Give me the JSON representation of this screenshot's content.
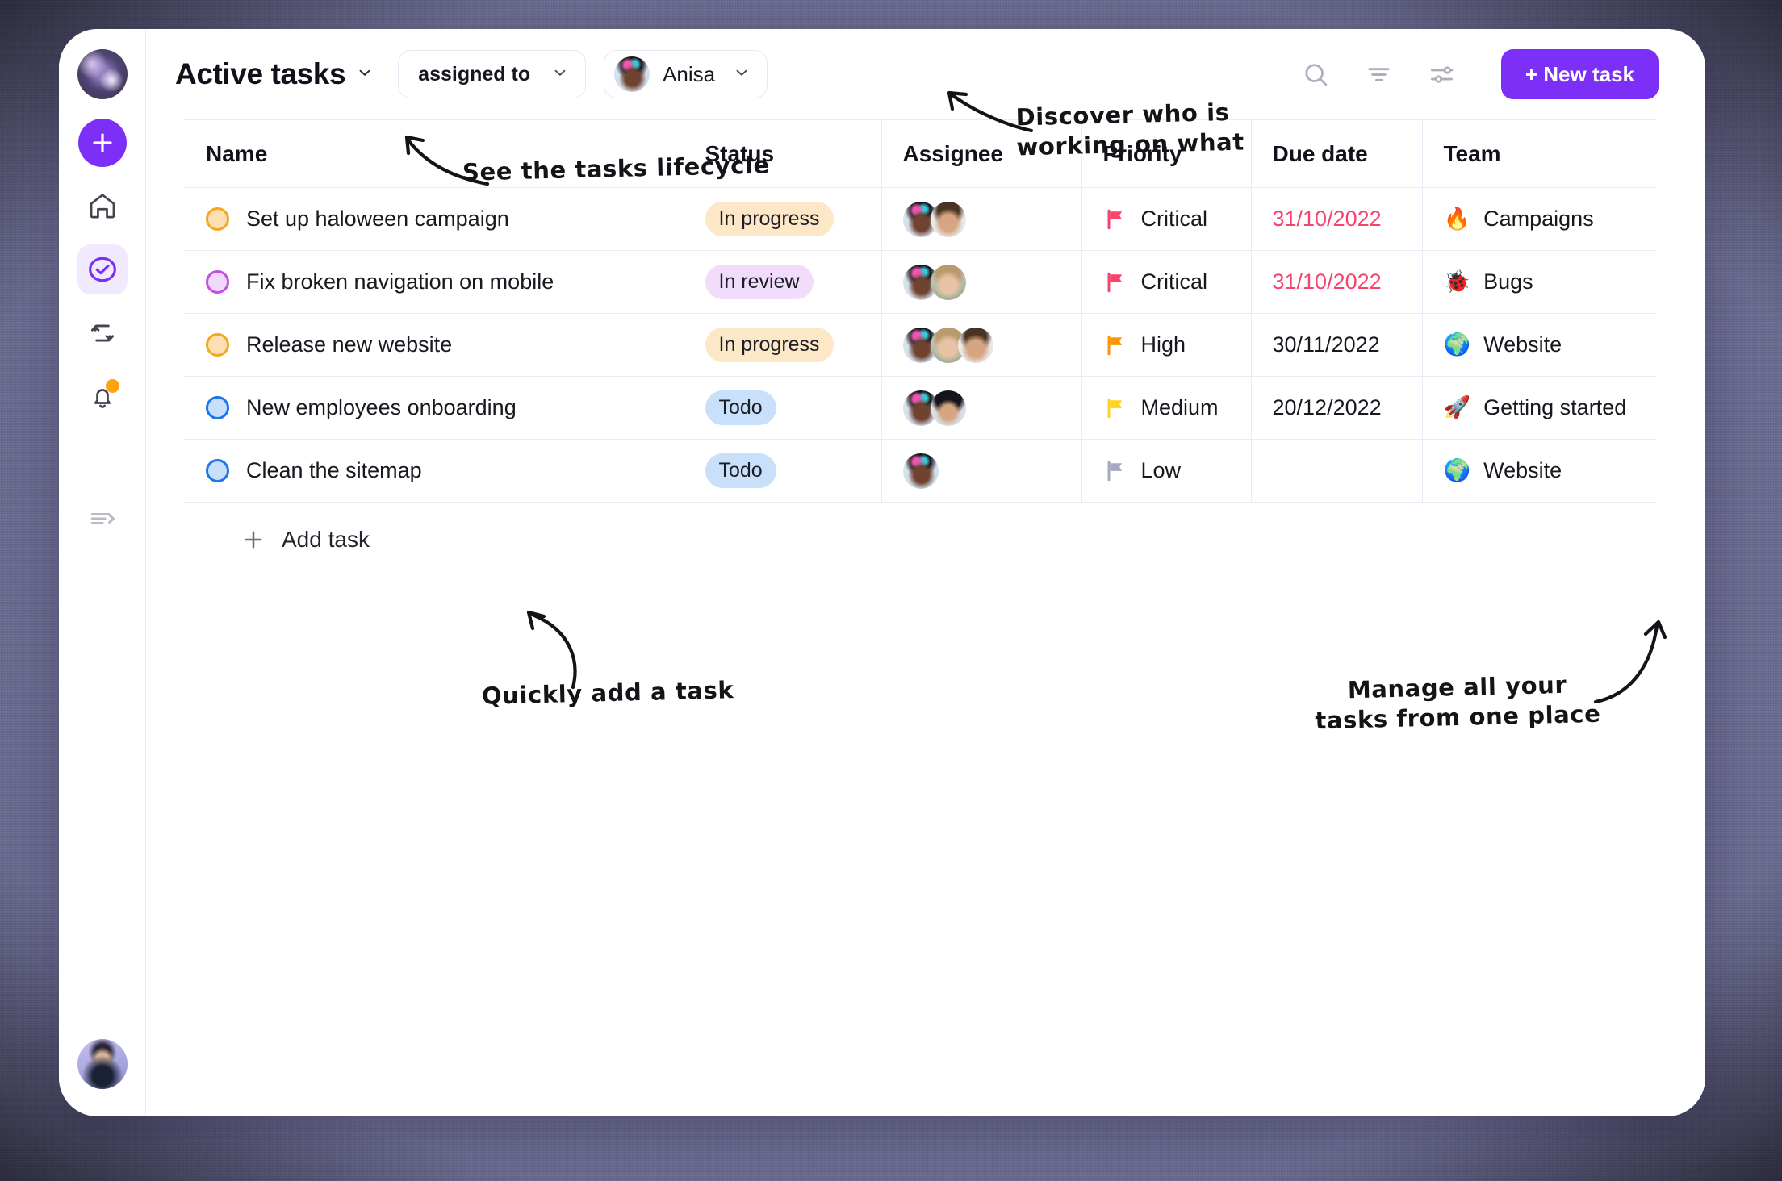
{
  "rail": {
    "workspace_name": "workspace-avatar",
    "add_label": "+",
    "items": [
      {
        "name": "home",
        "label": "Home"
      },
      {
        "name": "tasks",
        "label": "Tasks"
      },
      {
        "name": "sync",
        "label": "Sync"
      },
      {
        "name": "notifications",
        "label": "Notifications"
      }
    ],
    "collapse_label": "Expand sidebar",
    "user_label": "user-avatar"
  },
  "header": {
    "title": "Active tasks",
    "filter_label": "assigned to",
    "user_filter": "Anisa",
    "new_task_label": "+ New task",
    "search_icon": "search-icon",
    "filter_icon": "filter-icon",
    "settings_icon": "sliders-icon"
  },
  "table": {
    "columns": [
      "Name",
      "Status",
      "Assignee",
      "Priority",
      "Due date",
      "Team"
    ],
    "rows": [
      {
        "name": "Set up haloween campaign",
        "dot": "orange",
        "status": "In progress",
        "status_style": "progress",
        "assignees": [
          "a1",
          "a2"
        ],
        "priority": "Critical",
        "priority_color": "#f8436c",
        "due": "31/10/2022",
        "due_overdue": true,
        "team": "Campaigns",
        "team_emoji": "🔥"
      },
      {
        "name": "Fix broken navigation on mobile",
        "dot": "purple",
        "status": "In review",
        "status_style": "review",
        "assignees": [
          "a1",
          "a3"
        ],
        "priority": "Critical",
        "priority_color": "#f8436c",
        "due": "31/10/2022",
        "due_overdue": true,
        "team": "Bugs",
        "team_emoji": "🐞"
      },
      {
        "name": "Release new website",
        "dot": "orange",
        "status": "In progress",
        "status_style": "progress",
        "assignees": [
          "a1",
          "a3",
          "a2"
        ],
        "priority": "High",
        "priority_color": "#ff9500",
        "due": "30/11/2022",
        "due_overdue": false,
        "team": "Website",
        "team_emoji": "🌍"
      },
      {
        "name": "New employees onboarding",
        "dot": "blue",
        "status": "Todo",
        "status_style": "todo",
        "assignees": [
          "a1",
          "a4"
        ],
        "priority": "Medium",
        "priority_color": "#ffd21e",
        "due": "20/12/2022",
        "due_overdue": false,
        "team": "Getting started",
        "team_emoji": "🚀"
      },
      {
        "name": "Clean the sitemap",
        "dot": "blue",
        "status": "Todo",
        "status_style": "todo",
        "assignees": [
          "a1"
        ],
        "priority": "Low",
        "priority_color": "#a7a9c0",
        "due": "",
        "due_overdue": false,
        "team": "Website",
        "team_emoji": "🌍"
      }
    ],
    "add_task_label": "Add task"
  },
  "annotations": {
    "lifecycle": "See the tasks lifecycle",
    "discover": "Discover who is\nworking on what",
    "quick_add": "Quickly add a task",
    "manage": "Manage all your\ntasks from one place"
  },
  "colors": {
    "accent": "#7b2ff7",
    "overdue": "#f8436c",
    "status_progress": "#fce7c6",
    "status_review": "#f2dcfb",
    "status_todo": "#c9e0fb"
  }
}
